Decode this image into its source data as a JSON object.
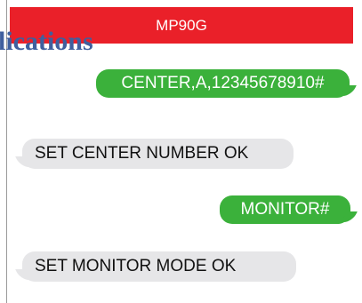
{
  "background_heading": "lications",
  "header": {
    "title": "MP90G"
  },
  "messages": [
    {
      "direction": "outgoing",
      "text": "CENTER,A,12345678910#"
    },
    {
      "direction": "incoming",
      "text": "SET CENTER NUMBER OK"
    },
    {
      "direction": "outgoing",
      "text": "MONITOR#"
    },
    {
      "direction": "incoming",
      "text": "SET MONITOR MODE OK"
    }
  ],
  "colors": {
    "header_bg": "#ea2029",
    "outgoing_bg": "#3bb13b",
    "incoming_bg": "#e6e6e8",
    "heading_text": "#3f5f9e"
  }
}
